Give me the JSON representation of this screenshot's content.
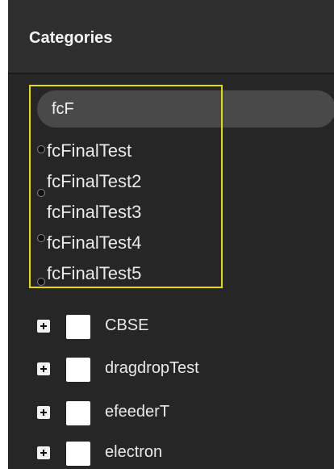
{
  "panel": {
    "title": "Categories"
  },
  "search": {
    "value": "fcF",
    "placeholder": ""
  },
  "suggestions": [
    "fcFinalTest",
    "fcFinalTest2",
    "fcFinalTest3",
    "fcFinalTest4",
    "fcFinalTest5"
  ],
  "tree": {
    "items": [
      {
        "label": "CBSE"
      },
      {
        "label": "dragdropTest"
      },
      {
        "label": "efeederT"
      },
      {
        "label": "electron"
      }
    ]
  }
}
